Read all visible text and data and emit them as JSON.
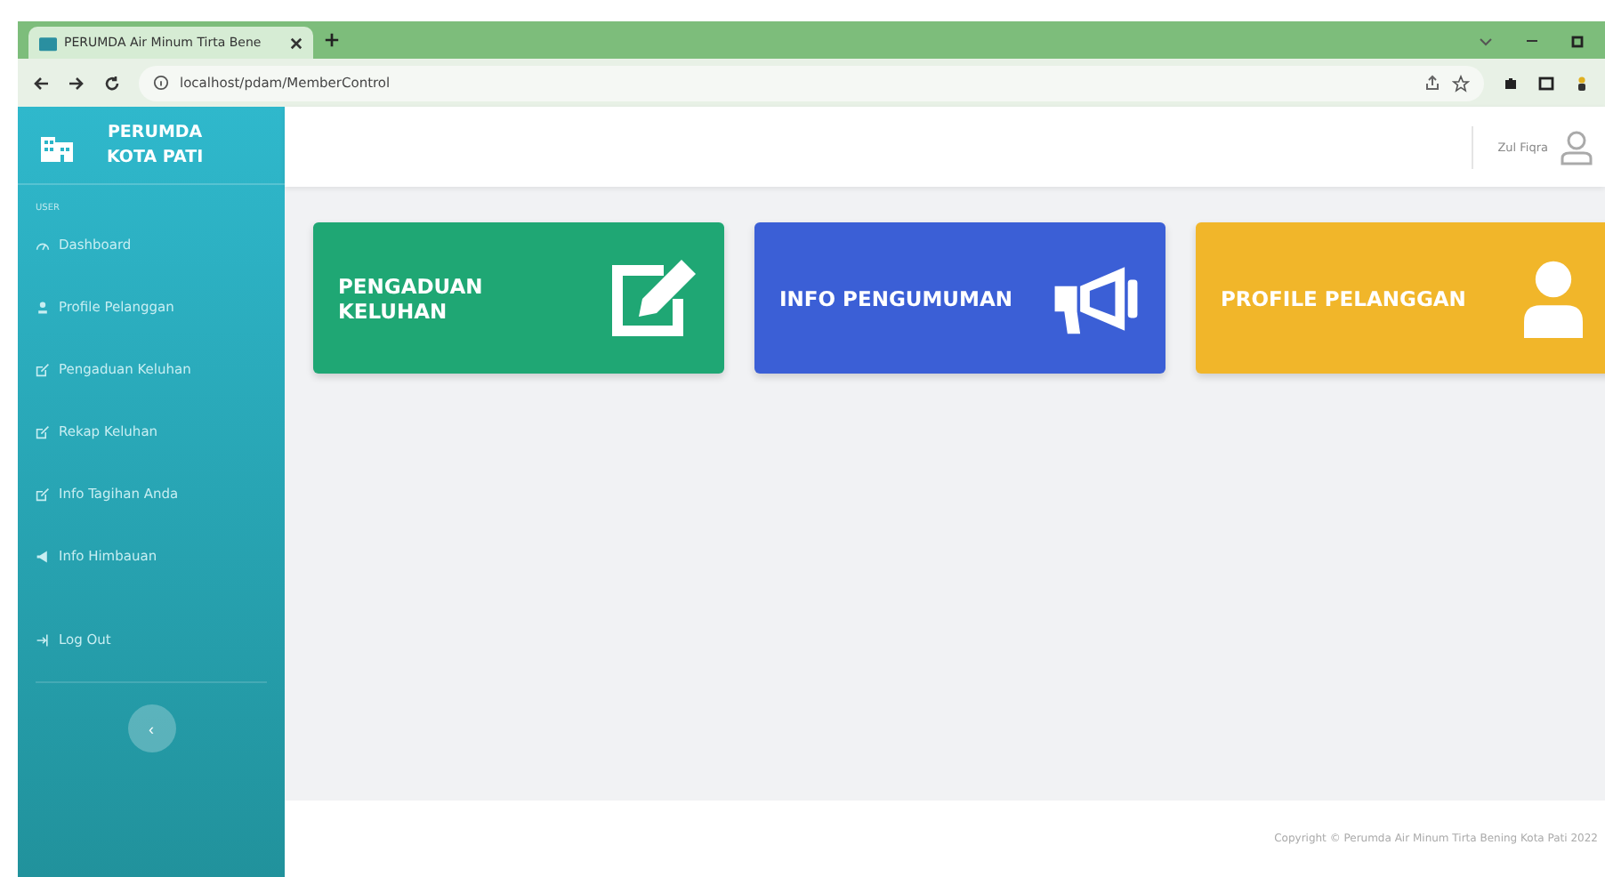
{
  "browser": {
    "tab_title": "PERUMDA Air Minum Tirta Bene",
    "url": "localhost/pdam/MemberControl"
  },
  "sidebar": {
    "brand": [
      "PERUMDA",
      "KOTA PATI"
    ],
    "section": "USER",
    "items": [
      {
        "label": "Dashboard",
        "kind": "dashboard",
        "selected": false
      },
      {
        "label": "Profile Pelanggan",
        "kind": "user",
        "selected": false
      },
      {
        "label": "Pengaduan Keluhan",
        "kind": "edit",
        "selected": false
      },
      {
        "label": "Rekap Keluhan",
        "kind": "edit",
        "selected": false
      },
      {
        "label": "Info Tagihan Anda",
        "kind": "edit",
        "selected": false
      },
      {
        "label": "Info Himbauan",
        "kind": "megaphone",
        "selected": false
      },
      {
        "label": "Log Out",
        "kind": "logout",
        "selected": false
      }
    ],
    "toggle": "‹"
  },
  "header": {
    "user": "Zul Fiqra"
  },
  "cards": [
    {
      "title": "PENGADUAN KELUHAN",
      "kind": "edit",
      "color": "#1fa774"
    },
    {
      "title": "INFO PENGUMUMAN",
      "kind": "megaphone",
      "color": "#3b5fd6"
    },
    {
      "title": "PROFILE PELANGGAN",
      "kind": "user",
      "color": "#f1b62a"
    }
  ],
  "footer": "Copyright © Perumda Air Minum Tirta Bening Kota Pati 2022"
}
